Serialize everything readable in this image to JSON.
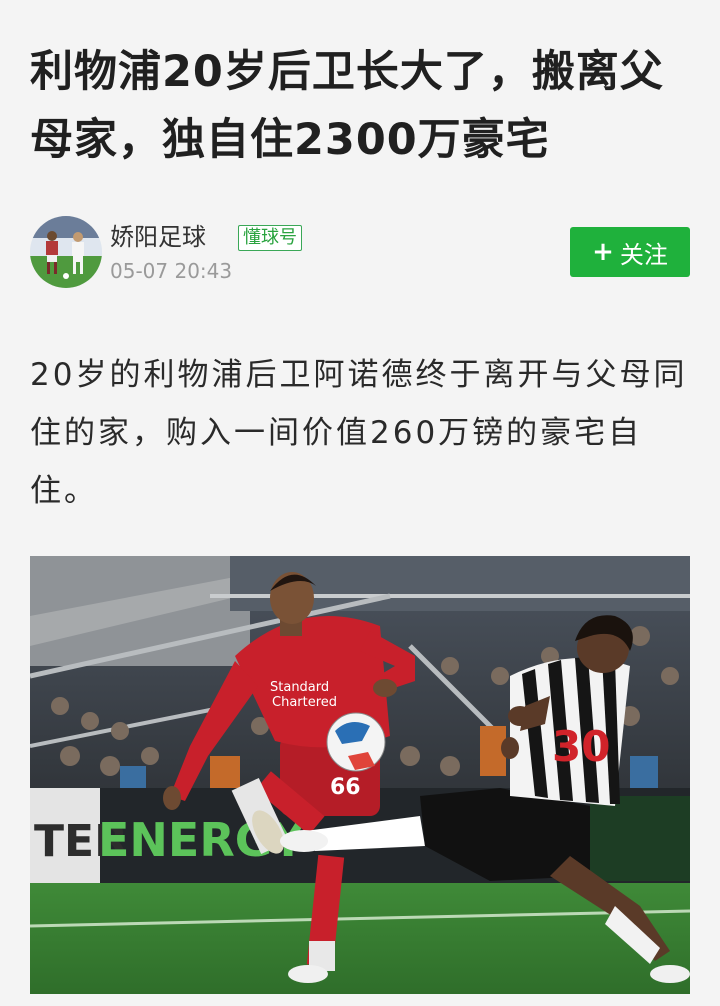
{
  "article": {
    "title": "利物浦20岁后卫长大了，搬离父母家，独自住2300万豪宅",
    "body": "20岁的利物浦后卫阿诺德终于离开与父母同住的家，购入一间价值260万镑的豪宅自住。"
  },
  "author": {
    "name": "娇阳足球",
    "badge": "懂球号",
    "time": "05-07 20:43"
  },
  "follow": {
    "plus": "+",
    "label": "关注"
  },
  "photo": {
    "board_text": "ENERGY",
    "board_text_left": "TER",
    "number_left": "66",
    "number_right": "30"
  },
  "colors": {
    "accent_green": "#1fb13c",
    "liverpool_red": "#c8202b"
  }
}
